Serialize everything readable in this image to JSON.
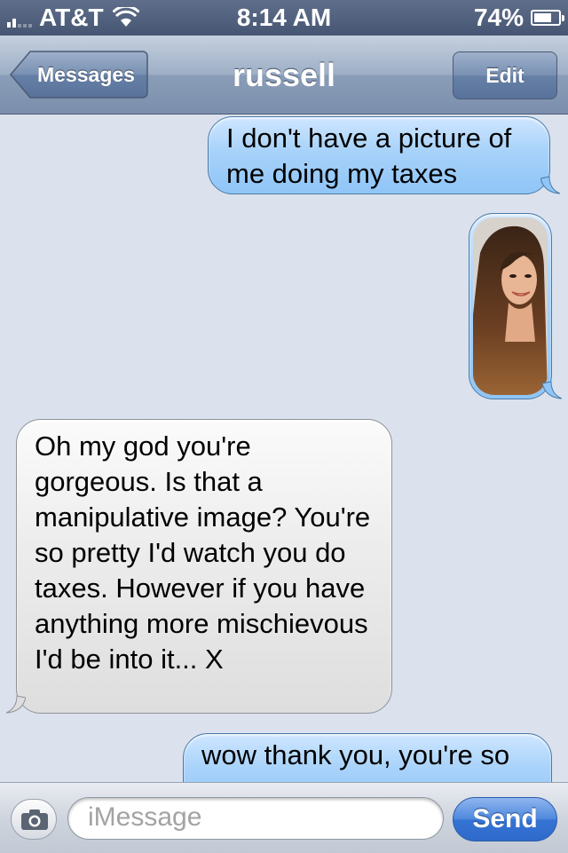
{
  "status_bar": {
    "carrier": "AT&T",
    "time": "8:14 AM",
    "battery_percent": "74%",
    "battery_level": 0.74,
    "icons": [
      "signal-icon",
      "wifi-icon",
      "battery-icon"
    ]
  },
  "nav": {
    "back_label": "Messages",
    "title": "russell",
    "edit_label": "Edit"
  },
  "messages": [
    {
      "direction": "sent",
      "type": "text",
      "text": "I don't have a picture of me doing my taxes"
    },
    {
      "direction": "sent",
      "type": "image"
    },
    {
      "direction": "received",
      "type": "text",
      "text": "Oh my god you're gorgeous. Is that a manipulative image? You're so pretty I'd watch you do taxes. However if you have anything more mischievous I'd be into it... X"
    },
    {
      "direction": "sent",
      "type": "text",
      "text": "wow thank you, you're so"
    }
  ],
  "composer": {
    "placeholder": "iMessage",
    "send_label": "Send",
    "camera_icon": "camera-icon"
  },
  "colors": {
    "sent_bubble": "#9ccbf8",
    "received_bubble": "#e6e6e6",
    "thread_background": "#dbe2ed",
    "send_button": "#3a78d6"
  }
}
